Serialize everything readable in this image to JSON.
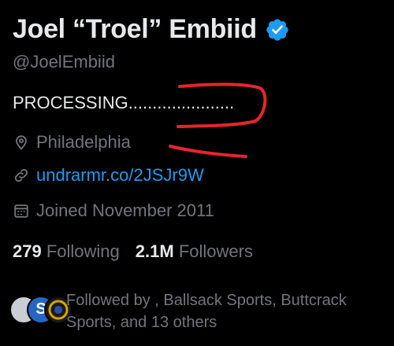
{
  "profile": {
    "display_name": "Joel “Troel” Embiid",
    "handle": "@JoelEmbiid",
    "bio": "PROCESSING......................",
    "location": "Philadelphia",
    "link": "undrarmr.co/2JSJr9W",
    "joined": "Joined November 2011"
  },
  "stats": {
    "following_count": "279",
    "following_label": "Following",
    "followers_count": "2.1M",
    "followers_label": "Followers"
  },
  "followed_by": {
    "text": "Followed by , Ballsack Sports, Buttcrack Sports, and 13 others",
    "avatar_letter": "S"
  },
  "colors": {
    "background": "#000000",
    "primary_text": "#e7e9ea",
    "secondary_text": "#71767b",
    "accent": "#1d9bf0",
    "annotation": "#e8242b"
  },
  "icons": {
    "verified": "verified-badge-icon",
    "location": "location-pin-icon",
    "link": "link-icon",
    "calendar": "calendar-icon"
  }
}
